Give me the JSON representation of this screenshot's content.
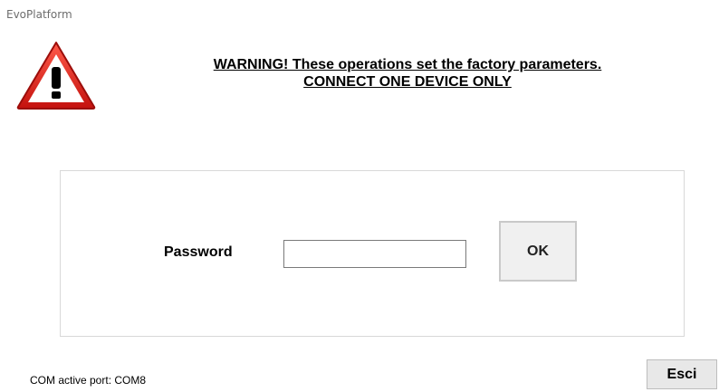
{
  "window": {
    "title": "EvoPlatform"
  },
  "warning": {
    "icon": "warning-triangle-icon",
    "line1": "WARNING! These operations set the factory parameters.",
    "line2": "CONNECT ONE DEVICE ONLY",
    "icon_color": "#d8201d"
  },
  "login": {
    "password_label": "Password",
    "password_value": "",
    "password_placeholder": "",
    "ok_label": "OK"
  },
  "footer": {
    "status_text": "COM active port: COM8",
    "exit_label": "Esci"
  }
}
